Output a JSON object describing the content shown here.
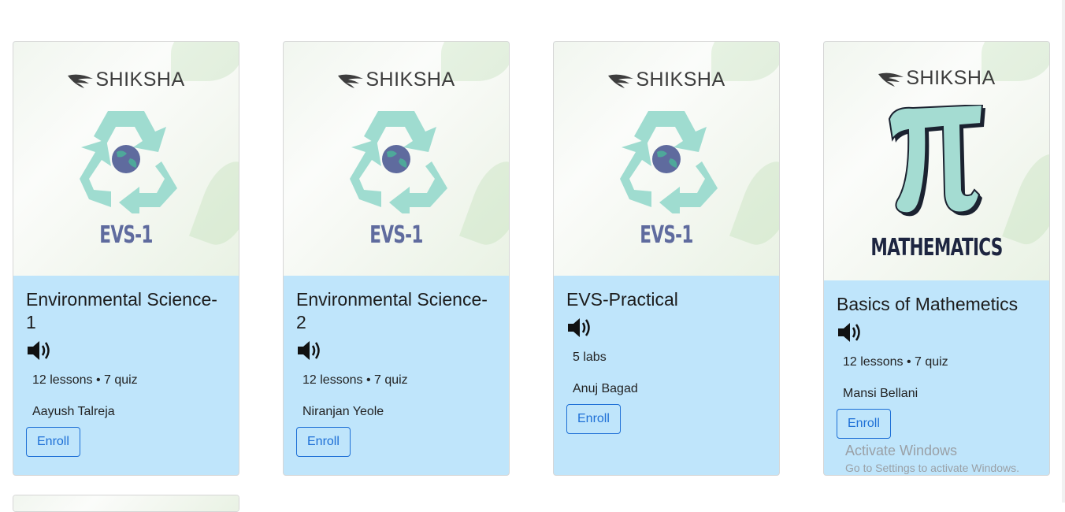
{
  "brand": "SHIKSHA",
  "colors": {
    "card_body": "#bfe5fb",
    "accent": "#1d6fd6",
    "evs_code": "#5f6b9e",
    "recycle": "#9fdcd0"
  },
  "courses": [
    {
      "thumb_label": "EVS-1",
      "art": "recycle-globe-icon",
      "title": "Environmental Science-1",
      "meta": "12 lessons • 7 quiz",
      "author": "Aayush Talreja",
      "enroll": "Enroll"
    },
    {
      "thumb_label": "EVS-1",
      "art": "recycle-globe-icon",
      "title": "Environmental Science-2",
      "meta": "12 lessons • 7 quiz",
      "author": "Niranjan Yeole",
      "enroll": "Enroll"
    },
    {
      "thumb_label": "EVS-1",
      "art": "recycle-globe-icon",
      "title": "EVS-Practical",
      "meta": "5 labs",
      "author": "Anuj Bagad",
      "enroll": "Enroll"
    },
    {
      "thumb_label": "MATHEMATICS",
      "art": "pi-symbol-icon",
      "title": "Basics of Mathemetics",
      "meta": "12 lessons • 7 quiz",
      "author": "Mansi Bellani",
      "enroll": "Enroll"
    }
  ],
  "watermark": {
    "line1": "Activate Windows",
    "line2": "Go to Settings to activate Windows."
  }
}
